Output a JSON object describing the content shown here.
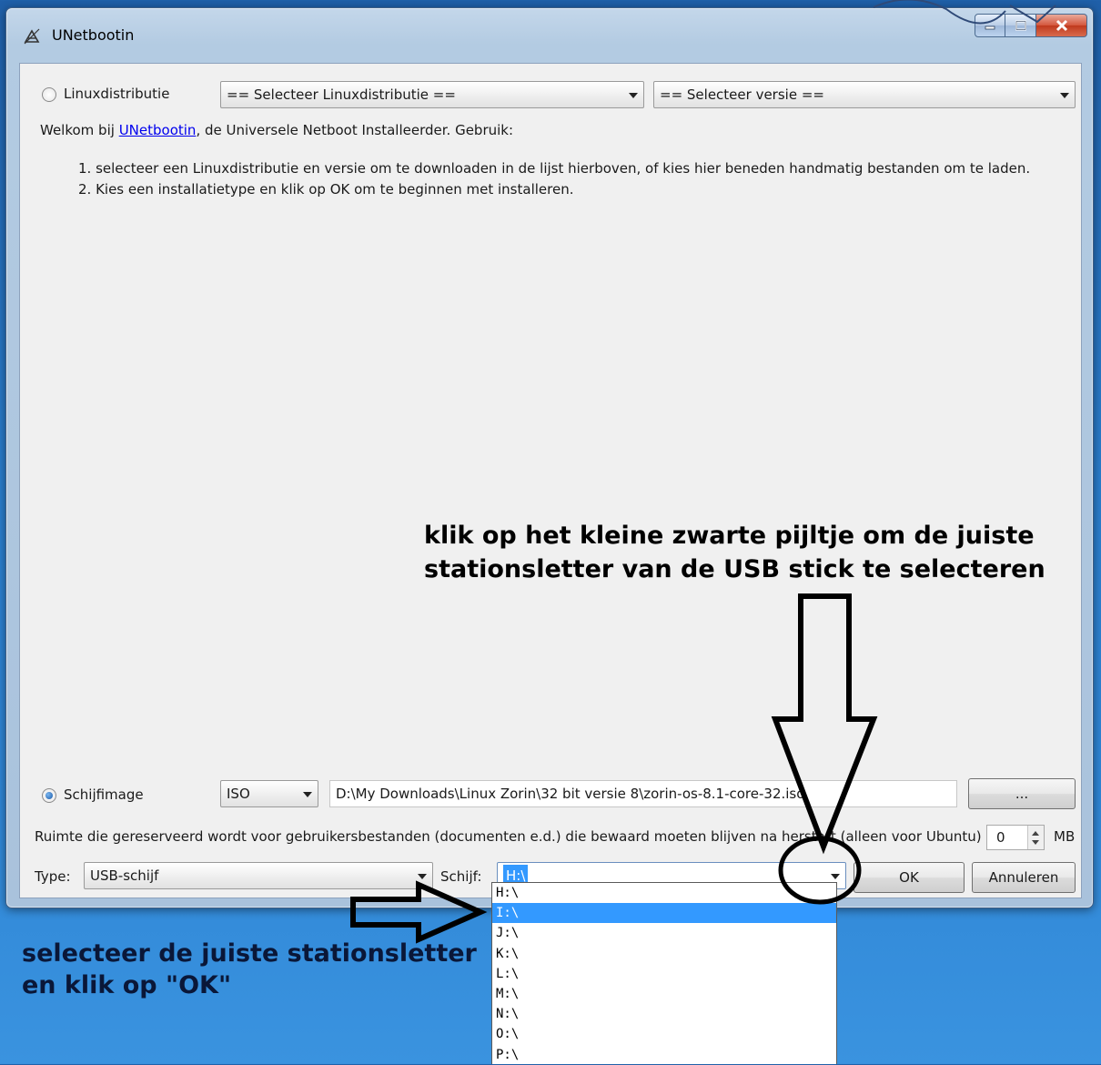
{
  "window": {
    "title": "UNetbootin",
    "icon": "unetbootin-app-icon",
    "controls": {
      "minimize": "minimize-icon",
      "maximize": "maximize-icon",
      "close": "close-icon"
    }
  },
  "distribution": {
    "radio_label": "Linuxdistributie",
    "distro_select": "== Selecteer Linuxdistributie ==",
    "version_select": "== Selecteer versie =="
  },
  "welcome": {
    "prefix": "Welkom bij ",
    "link": "UNetbootin",
    "suffix": ", de Universele Netboot Installeerder. Gebruik:",
    "steps": [
      "1. selecteer een Linuxdistributie en versie om te downloaden in de lijst hierboven, of kies hier beneden handmatig bestanden om te laden.",
      "2. Kies een installatietype en klik op OK om te beginnen met installeren."
    ]
  },
  "diskimage": {
    "radio_label": "Schijfimage",
    "format": "ISO",
    "path": "D:\\My Downloads\\Linux Zorin\\32 bit versie 8\\zorin-os-8.1-core-32.iso",
    "browse_label": "..."
  },
  "reserved": {
    "text": "Ruimte die gereserveerd wordt voor gebruikersbestanden (documenten e.d.) die bewaard moeten blijven na herstart (alleen voor Ubuntu)",
    "value": "0",
    "unit": "MB"
  },
  "install": {
    "type_label": "Type:",
    "type_value": "USB-schijf",
    "drive_label": "Schijf:",
    "drive_value": "H:\\",
    "ok_label": "OK",
    "cancel_label": "Annuleren"
  },
  "drive_list": {
    "items": [
      "H:\\",
      "I:\\",
      "J:\\",
      "K:\\",
      "L:\\",
      "M:\\",
      "N:\\",
      "O:\\",
      "P:\\"
    ],
    "highlighted": "I:\\"
  },
  "annotations": {
    "top_line1": "klik op het kleine zwarte pijltje om de juiste",
    "top_line2": "stationsletter van de USB stick te selecteren",
    "bottom_line1": "selecteer de juiste stationsletter",
    "bottom_line2": "en klik op \"OK\""
  },
  "colors": {
    "desktop": "#2a7dcc",
    "selection": "#3399ff",
    "link": "#0000ee"
  }
}
